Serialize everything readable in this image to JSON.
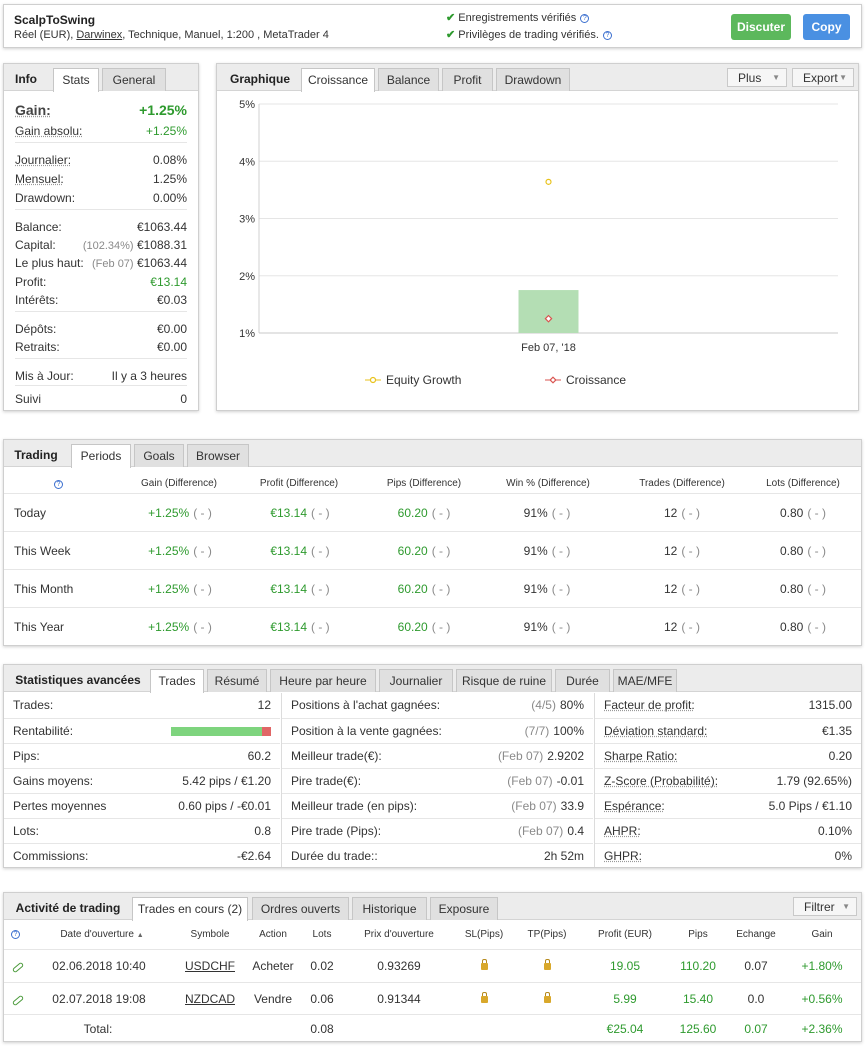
{
  "header": {
    "name": "ScalpToSwing",
    "details_prefix": "Réel (EUR), ",
    "broker": "Darwinex",
    "details_suffix": ", Technique, Manuel, 1:200 , MetaTrader 4",
    "verified_records": "Enregistrements vérifiés",
    "verified_privileges": "Privilèges de trading vérifiés.",
    "discuss_label": "Discuter",
    "copy_label": "Copy",
    "colors": {
      "discuss": "#5cb85c",
      "copy": "#4a90e2"
    }
  },
  "info": {
    "tabs": [
      "Info",
      "Stats",
      "General"
    ],
    "gain_label": "Gain:",
    "gain_value": "+1.25%",
    "abs_gain_label": "Gain absolu:",
    "abs_gain_value": "+1.25%",
    "daily_label": "Journalier:",
    "daily_value": "0.08%",
    "monthly_label": "Mensuel:",
    "monthly_value": "1.25%",
    "drawdown_label": "Drawdown:",
    "drawdown_value": "0.00%",
    "balance_label": "Balance:",
    "balance_value": "€1063.44",
    "equity_label": "Capital:",
    "equity_pct": "(102.34%)",
    "equity_value": "€1088.31",
    "highest_label": "Le plus haut:",
    "highest_date": "(Feb 07)",
    "highest_value": "€1063.44",
    "profit_label": "Profit:",
    "profit_value": "€13.14",
    "interest_label": "Intérêts:",
    "interest_value": "€0.03",
    "deposits_label": "Dépôts:",
    "deposits_value": "€0.00",
    "withdrawals_label": "Retraits:",
    "withdrawals_value": "€0.00",
    "updated_label": "Mis à Jour:",
    "updated_value": "Il y a 3 heures",
    "followers_label": "Suivi",
    "followers_value": "0"
  },
  "graph": {
    "tabs": [
      "Graphique",
      "Croissance",
      "Balance",
      "Profit",
      "Drawdown"
    ],
    "plus_label": "Plus",
    "export_label": "Export"
  },
  "chart_data": {
    "type": "bar",
    "categories": [
      "Feb 07, '18"
    ],
    "series": [
      {
        "name": "Equity Growth",
        "type": "line",
        "values": [
          3.64
        ],
        "color": "#e8c21b"
      },
      {
        "name": "Croissance",
        "type": "bar",
        "values": [
          1.25
        ],
        "color": "#d9534f",
        "bar_color": "#b4deb4"
      }
    ],
    "y_ticks": [
      "5%",
      "4%",
      "3%",
      "2%",
      "1%"
    ],
    "ylim": [
      1,
      5
    ],
    "grid": true,
    "legend": "bottom"
  },
  "trading": {
    "tabs": [
      "Trading",
      "Periods",
      "Goals",
      "Browser"
    ],
    "columns": [
      "Gain (Difference)",
      "Profit (Difference)",
      "Pips (Difference)",
      "Win % (Difference)",
      "Trades (Difference)",
      "Lots (Difference)"
    ],
    "rows": [
      {
        "period": "Today",
        "gain": "+1.25%",
        "profit": "€13.14",
        "pips": "60.20",
        "win": "91%",
        "trades": "12",
        "lots": "0.80",
        "diff": "( - )"
      },
      {
        "period": "This Week",
        "gain": "+1.25%",
        "profit": "€13.14",
        "pips": "60.20",
        "win": "91%",
        "trades": "12",
        "lots": "0.80",
        "diff": "( - )"
      },
      {
        "period": "This Month",
        "gain": "+1.25%",
        "profit": "€13.14",
        "pips": "60.20",
        "win": "91%",
        "trades": "12",
        "lots": "0.80",
        "diff": "( - )"
      },
      {
        "period": "This Year",
        "gain": "+1.25%",
        "profit": "€13.14",
        "pips": "60.20",
        "win": "91%",
        "trades": "12",
        "lots": "0.80",
        "diff": "( - )"
      }
    ]
  },
  "advanced": {
    "tabs": [
      "Statistiques avancées",
      "Trades",
      "Résumé",
      "Heure par heure",
      "Journalier",
      "Risque de ruine",
      "Durée",
      "MAE/MFE"
    ],
    "col1": [
      {
        "label": "Trades:",
        "value": "12"
      },
      {
        "label": "Rentabilité:",
        "value": "",
        "bar": true,
        "win_fraction": 0.91
      },
      {
        "label": "Pips:",
        "value": "60.2"
      },
      {
        "label": "Gains moyens:",
        "value": "5.42 pips / €1.20"
      },
      {
        "label": "Pertes moyennes",
        "value": "0.60 pips / -€0.01"
      },
      {
        "label": "Lots:",
        "value": "0.8"
      },
      {
        "label": "Commissions:",
        "value": "-€2.64"
      }
    ],
    "col2": [
      {
        "label": "Positions à l'achat gagnées:",
        "note": "(4/5)",
        "value": "80%"
      },
      {
        "label": "Position à la vente gagnées:",
        "note": "(7/7)",
        "value": "100%"
      },
      {
        "label": "Meilleur trade(€):",
        "note": "(Feb 07)",
        "value": "2.9202"
      },
      {
        "label": "Pire trade(€):",
        "note": "(Feb 07)",
        "value": "-0.01"
      },
      {
        "label": "Meilleur trade (en pips):",
        "note": "(Feb 07)",
        "value": "33.9"
      },
      {
        "label": "Pire trade (Pips):",
        "note": "(Feb 07)",
        "value": "0.4"
      },
      {
        "label": "Durée du trade::",
        "note": "",
        "value": "2h 52m"
      }
    ],
    "col3": [
      {
        "label": "Facteur de profit:",
        "value": "1315.00"
      },
      {
        "label": "Déviation standard:",
        "value": "€1.35"
      },
      {
        "label": "Sharpe Ratio:",
        "value": "0.20"
      },
      {
        "label": "Z-Score (Probabilité):",
        "value": "1.79 (92.65%)"
      },
      {
        "label": "Espérance:",
        "value": "5.0 Pips / €1.10"
      },
      {
        "label": "AHPR:",
        "value": "0.10%"
      },
      {
        "label": "GHPR:",
        "value": "0%"
      }
    ],
    "colors": {
      "win": "#7ed47e",
      "loss": "#e06666"
    }
  },
  "activity": {
    "tabs": [
      "Activité de trading",
      "Trades en cours (2)",
      "Ordres ouverts",
      "Historique",
      "Exposure"
    ],
    "filter_label": "Filtrer",
    "columns": [
      "Date d'ouverture",
      "Symbole",
      "Action",
      "Lots",
      "Prix d'ouverture",
      "SL(Pips)",
      "TP(Pips)",
      "Profit (EUR)",
      "Pips",
      "Echange",
      "Gain"
    ],
    "sort_indicator": "▲",
    "rows": [
      {
        "date": "02.06.2018 10:40",
        "symbol": "USDCHF",
        "action": "Acheter",
        "lots": "0.02",
        "price": "0.93269",
        "profit": "19.05",
        "pips": "110.20",
        "swap": "0.07",
        "gain": "+1.80%"
      },
      {
        "date": "02.07.2018 19:08",
        "symbol": "NZDCAD",
        "action": "Vendre",
        "lots": "0.06",
        "price": "0.91344",
        "profit": "5.99",
        "pips": "15.40",
        "swap": "0.0",
        "gain": "+0.56%"
      }
    ],
    "total": {
      "label": "Total:",
      "lots": "0.08",
      "profit": "€25.04",
      "pips": "125.60",
      "swap": "0.07",
      "gain": "+2.36%"
    }
  }
}
